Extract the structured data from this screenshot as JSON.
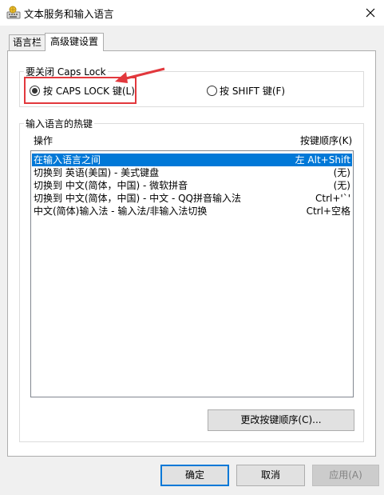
{
  "window": {
    "title": "文本服务和输入语言",
    "app_icon": "keyboard-language-icon",
    "close_icon": "close-icon"
  },
  "tabs": [
    {
      "label": "语言栏",
      "active": false
    },
    {
      "label": "高级键设置",
      "active": true
    }
  ],
  "caps_lock_group": {
    "legend": "要关闭 Caps Lock",
    "option_caps": {
      "label": "按 CAPS LOCK 键(L)",
      "selected": true
    },
    "option_shift": {
      "label": "按 SHIFT 键(F)",
      "selected": false
    }
  },
  "hotkeys_group": {
    "legend": "输入语言的热键",
    "col_action": "操作",
    "col_key_sequence": "按键顺序(K)",
    "rows": [
      {
        "action": "在输入语言之间",
        "keys": "左 Alt+Shift",
        "selected": true
      },
      {
        "action": "切换到 英语(美国) - 美式键盘",
        "keys": "(无)",
        "selected": false
      },
      {
        "action": "切换到 中文(简体，中国) - 微软拼音",
        "keys": "(无)",
        "selected": false
      },
      {
        "action": "切换到 中文(简体，中国) - 中文 - QQ拼音输入法",
        "keys": "Ctrl+'`'",
        "selected": false
      },
      {
        "action": "中文(简体)输入法 - 输入法/非输入法切换",
        "keys": "Ctrl+空格",
        "selected": false
      }
    ],
    "change_sequence_button": "更改按键顺序(C)..."
  },
  "footer": {
    "ok": "确定",
    "cancel": "取消",
    "apply": "应用(A)",
    "apply_enabled": false
  },
  "annotation": {
    "highlight_color": "#e2383d"
  }
}
